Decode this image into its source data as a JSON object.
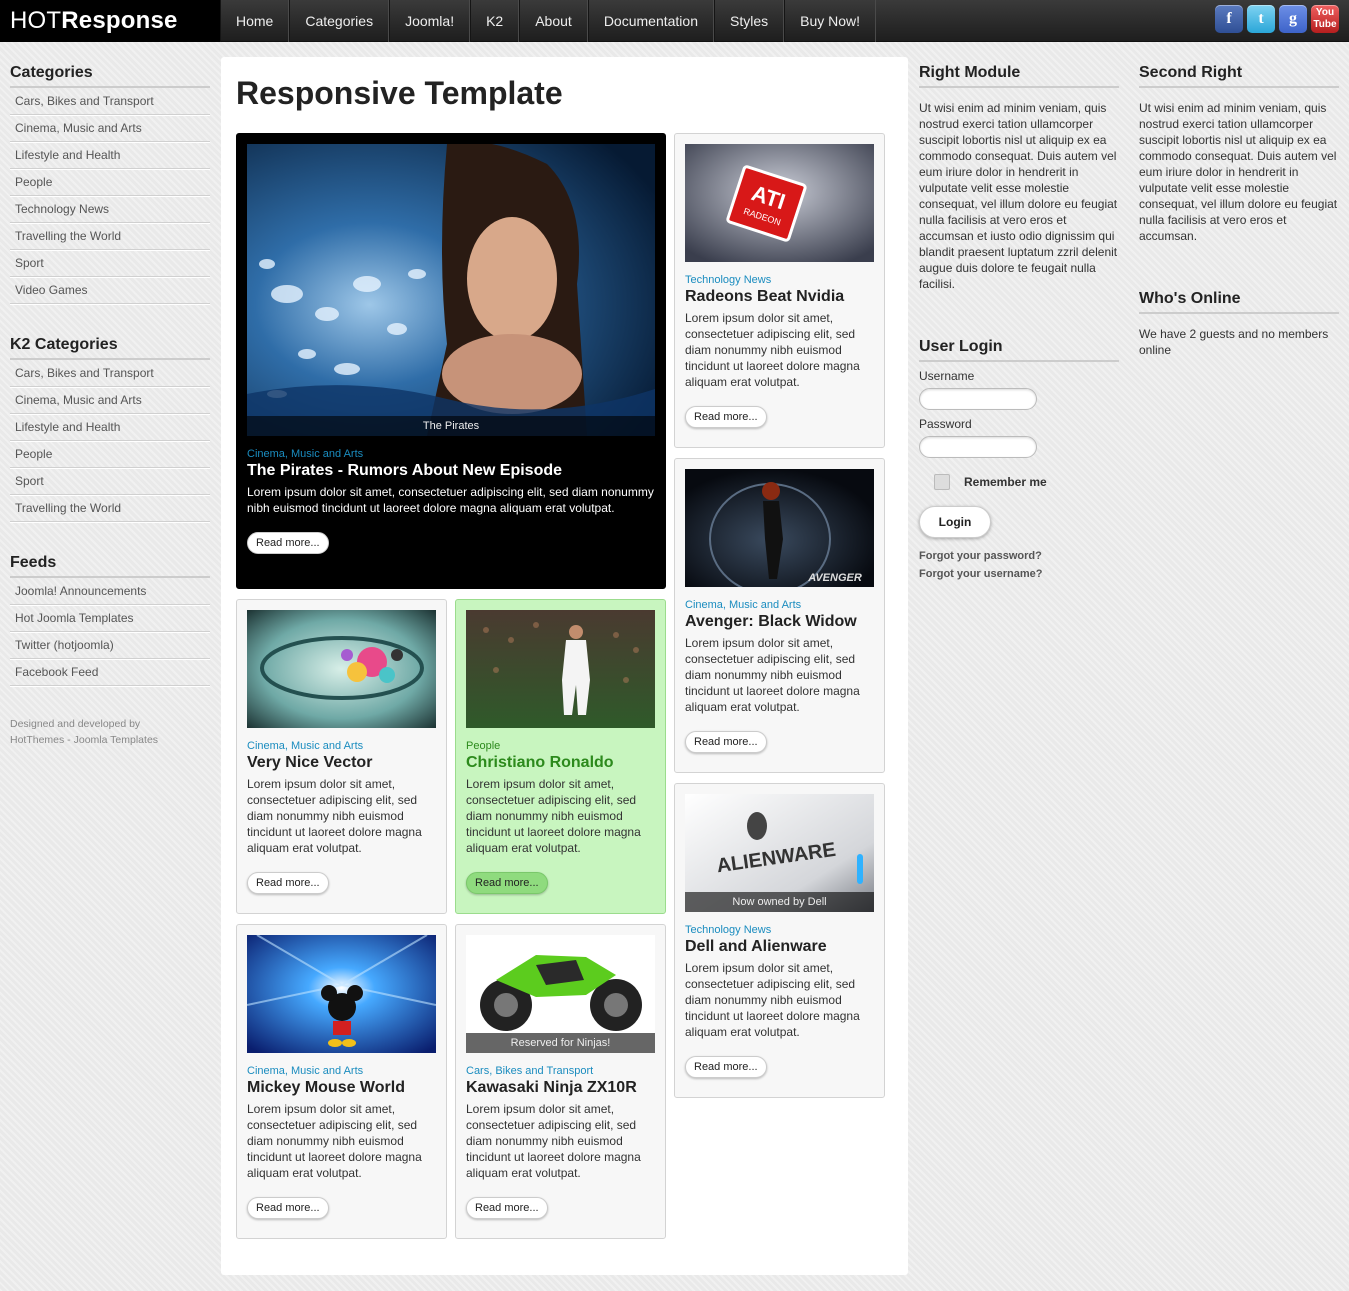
{
  "header": {
    "logo_light": "HOT",
    "logo_bold": "Response",
    "nav": [
      "Home",
      "Categories",
      "Joomla!",
      "K2",
      "About",
      "Documentation",
      "Styles",
      "Buy Now!"
    ],
    "social": {
      "facebook": "f",
      "twitter": "t",
      "google": "g",
      "youtube": "You Tube"
    }
  },
  "left": {
    "categories": {
      "title": "Categories",
      "items": [
        "Cars, Bikes and Transport",
        "Cinema, Music and Arts",
        "Lifestyle and Health",
        "People",
        "Technology News",
        "Travelling the World",
        "Sport",
        "Video Games"
      ]
    },
    "k2": {
      "title": "K2 Categories",
      "items": [
        "Cars, Bikes and Transport",
        "Cinema, Music and Arts",
        "Lifestyle and Health",
        "People",
        "Sport",
        "Travelling the World"
      ]
    },
    "feeds": {
      "title": "Feeds",
      "items": [
        "Joomla! Announcements",
        "Hot Joomla Templates",
        "Twitter (hotjoomla)",
        "Facebook Feed"
      ]
    },
    "credits_line1": "Designed and developed by",
    "credits_line2": "HotThemes - Joomla Templates"
  },
  "main": {
    "title": "Responsive Template",
    "read_more": "Read more...",
    "lorem": "Lorem ipsum dolor sit amet, consectetuer adipiscing elit, sed diam nonummy nibh euismod tincidunt ut laoreet dolore magna aliquam erat volutpat.",
    "articles": {
      "pirates": {
        "caption": "The Pirates",
        "category": "Cinema, Music and Arts",
        "title": "The Pirates - Rumors About New Episode"
      },
      "radeon": {
        "category": "Technology News",
        "title": "Radeons Beat Nvidia"
      },
      "widow": {
        "category": "Cinema, Music and Arts",
        "title": "Avenger: Black Widow"
      },
      "vector": {
        "category": "Cinema, Music and Arts",
        "title": "Very Nice Vector"
      },
      "ronaldo": {
        "category": "People",
        "title": "Christiano Ronaldo"
      },
      "alienware": {
        "caption": "Now owned by Dell",
        "category": "Technology News",
        "title": "Dell and Alienware"
      },
      "mickey": {
        "category": "Cinema, Music and Arts",
        "title": "Mickey Mouse World"
      },
      "ninja": {
        "caption": "Reserved for Ninjas!",
        "category": "Cars, Bikes and Transport",
        "title": "Kawasaki Ninja ZX10R"
      }
    }
  },
  "right": {
    "module_title": "Right Module",
    "module_text": "Ut wisi enim ad minim veniam, quis nostrud exerci tation ullamcorper suscipit lobortis nisl ut aliquip ex ea commodo consequat. Duis autem vel eum iriure dolor in hendrerit in vulputate velit esse molestie consequat, vel illum dolore eu feugiat nulla facilisis at vero eros et accumsan et iusto odio dignissim qui blandit praesent luptatum zzril delenit augue duis dolore te feugait nulla facilisi.",
    "login": {
      "title": "User Login",
      "username_label": "Username",
      "password_label": "Password",
      "remember": "Remember me",
      "button": "Login",
      "forgot_password": "Forgot your password?",
      "forgot_username": "Forgot your username?"
    }
  },
  "right2": {
    "title": "Second Right",
    "text": "Ut wisi enim ad minim veniam, quis nostrud exerci tation ullamcorper suscipit lobortis nisl ut aliquip ex ea commodo consequat. Duis autem vel eum iriure dolor in hendrerit in vulputate velit esse molestie consequat, vel illum dolore eu feugiat nulla facilisis at vero eros et accumsan.",
    "online_title": "Who's Online",
    "online_text": "We have 2 guests and no members online"
  }
}
